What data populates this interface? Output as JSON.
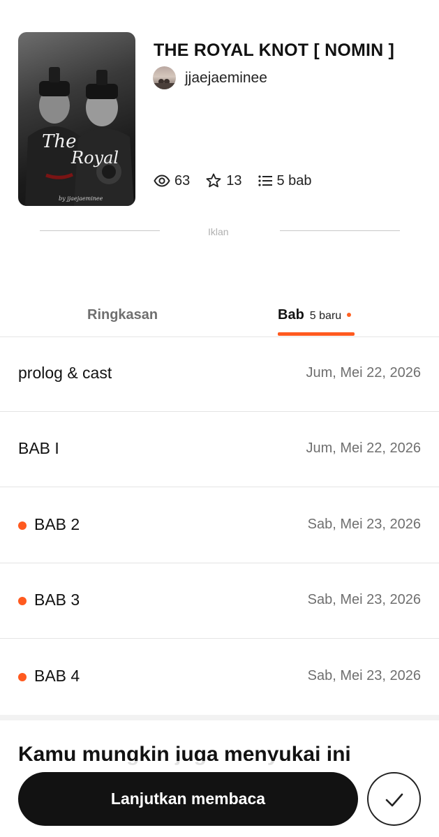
{
  "story": {
    "title": "THE ROYAL KNOT [ NOMIN ]",
    "author": "jjaejaeminee",
    "cover_text_line1": "The",
    "cover_text_line2": "Royal",
    "cover_byline": "by jjaejaeminee"
  },
  "stats": {
    "views": "63",
    "votes": "13",
    "parts": "5 bab"
  },
  "ad": {
    "label": "Iklan"
  },
  "tabs": {
    "summary": "Ringkasan",
    "chapters": "Bab",
    "chapters_new": "5 baru"
  },
  "chapters": [
    {
      "title": "prolog & cast",
      "date": "Jum, Mei 22, 2026",
      "is_new": false
    },
    {
      "title": "BAB I",
      "date": "Jum, Mei 22, 2026",
      "is_new": false
    },
    {
      "title": "BAB 2",
      "date": "Sab, Mei 23, 2026",
      "is_new": true
    },
    {
      "title": "BAB 3",
      "date": "Sab, Mei 23, 2026",
      "is_new": true
    },
    {
      "title": "BAB 4",
      "date": "Sab, Mei 23, 2026",
      "is_new": true
    }
  ],
  "recommendations": {
    "heading": "Kamu mungkin juga menyukai ini"
  },
  "actions": {
    "continue_label": "Lanjutkan membaca"
  },
  "colors": {
    "accent": "#ff5a1f",
    "text": "#121212",
    "muted": "#6f6f6f"
  },
  "icons": [
    "eye-icon",
    "star-icon",
    "list-icon",
    "check-icon"
  ]
}
